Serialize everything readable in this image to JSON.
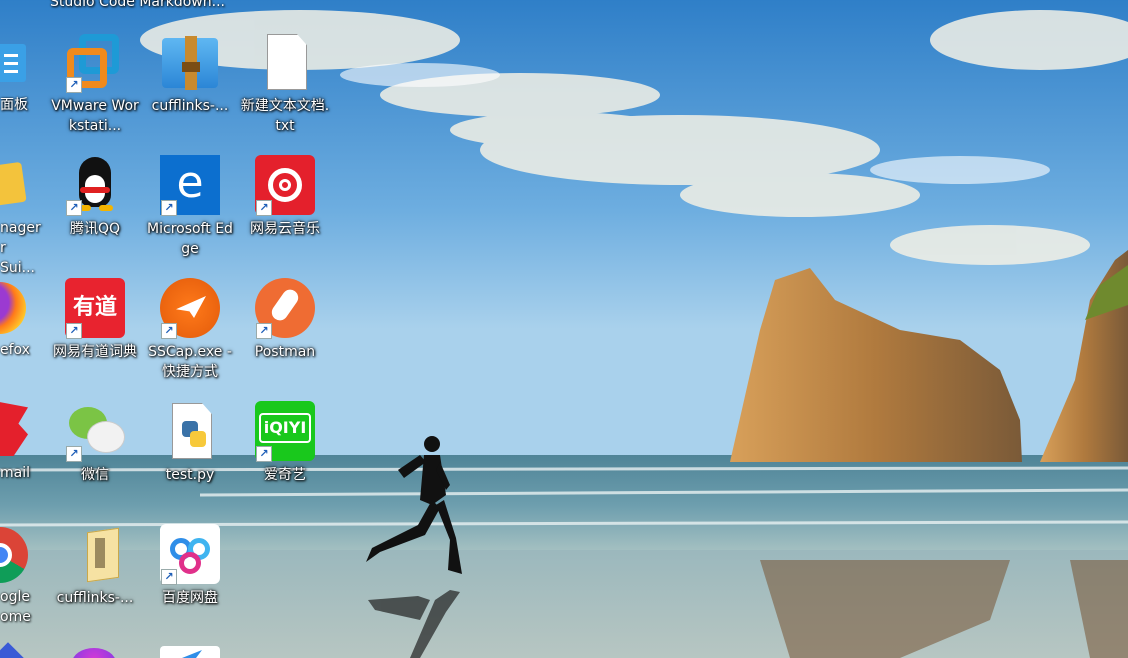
{
  "top_clipped_label": "Studio Code Markdown...",
  "left_column": {
    "item1_label": "面板",
    "item2_label_line1": "nager",
    "item2_label_line2": "r Sui...",
    "item3_label": "efox",
    "item4_label": "mail",
    "item5_label_line1": "ogle",
    "item5_label_line2": "ome"
  },
  "icons": {
    "vmware": "VMware Workstati...",
    "cufflinks_zip": "cufflinks-...",
    "new_txt": "新建文本文档.txt",
    "qq": "腾讯QQ",
    "edge": "Microsoft Edge",
    "netease_music": "网易云音乐",
    "youdao": "网易有道词典",
    "sscap": "SSCap.exe - 快捷方式",
    "postman": "Postman",
    "wechat": "微信",
    "testpy": "test.py",
    "iqiyi": "爱奇艺",
    "cufflinks_folder": "cufflinks-...",
    "baidu_pan": "百度网盘"
  },
  "glyphs": {
    "shortcut_arrow": "↗",
    "edge_letter": "e",
    "youdao_text": "有道",
    "iqiyi_text": "iQIYI"
  },
  "colors": {
    "sky_top": "#2f7fc8",
    "sea": "#5f93a6",
    "sand": "#9fb7b8",
    "edge_blue": "#0c6fcf",
    "netease_red": "#e4202c",
    "youdao_red": "#e8232f",
    "postman_orange": "#ef6c33",
    "iqiyi_green": "#19c81c"
  }
}
